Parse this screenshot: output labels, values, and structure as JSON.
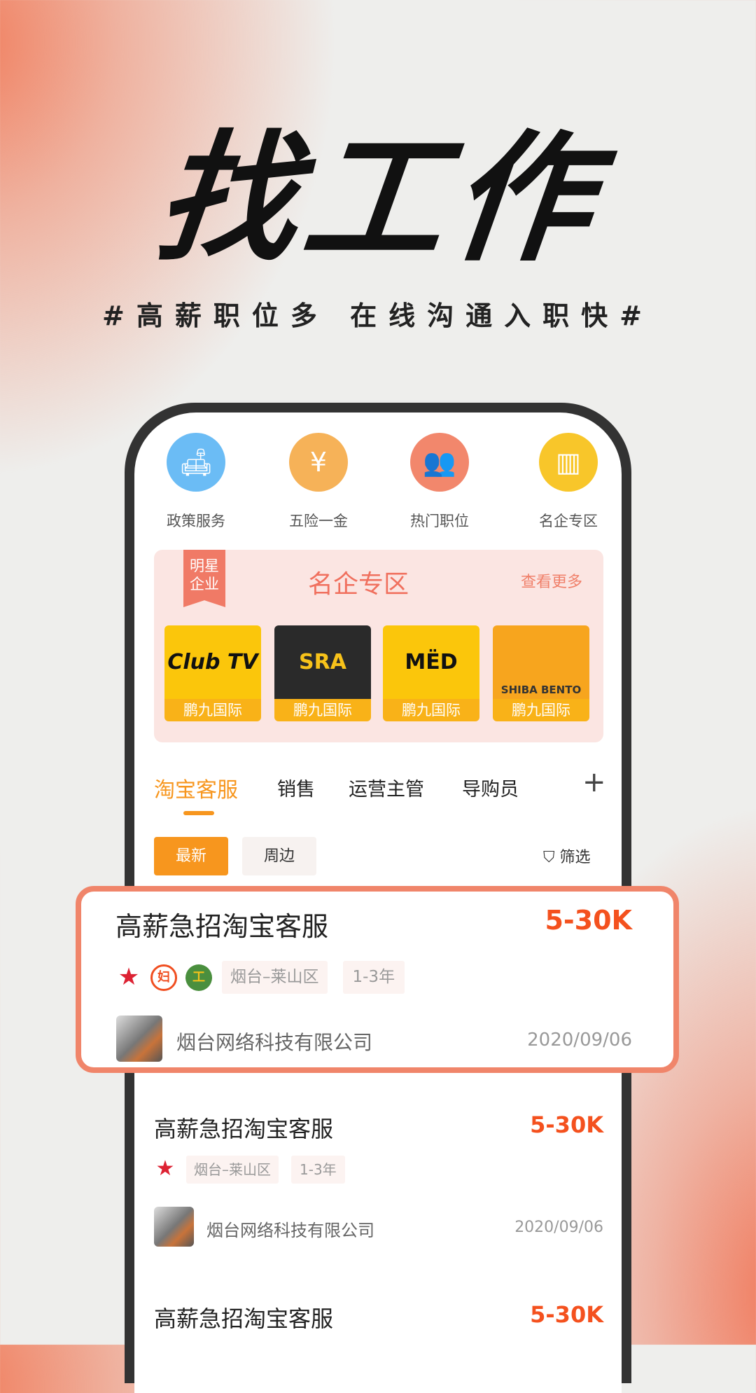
{
  "hero": {
    "title": "找工作",
    "subtitle": "#高薪职位多 在线沟通入职快#"
  },
  "quick": [
    {
      "label": "政策服务",
      "icon": "sofa-icon",
      "color": "#6bbcf5"
    },
    {
      "label": "五险一金",
      "icon": "yen-ticket-icon",
      "color": "#f6b258"
    },
    {
      "label": "热门职位",
      "icon": "people-icon",
      "color": "#f2876c"
    },
    {
      "label": "名企专区",
      "icon": "building-icon",
      "color": "#f8c62a"
    }
  ],
  "banner": {
    "ribbon": "明星企业",
    "title": "名企专区",
    "more": "查看更多",
    "logos": [
      {
        "brand": "Club TV",
        "name": "鹏九国际"
      },
      {
        "brand": "SRA",
        "name": "鹏九国际"
      },
      {
        "brand": "MËD",
        "name": "鹏九国际"
      },
      {
        "brand": "SHIBA BENTO",
        "name": "鹏九国际"
      }
    ]
  },
  "tabs": [
    "淘宝客服",
    "销售",
    "运营主管",
    "导购员"
  ],
  "filters": {
    "latest": "最新",
    "nearby": "周边",
    "filter": "筛选"
  },
  "jobs": [
    {
      "title": "高薪急招淘宝客服",
      "salary": "5-30K",
      "location": "烟台–莱山区",
      "experience": "1-3年",
      "company": "烟台网络科技有限公司",
      "date": "2020/09/06"
    },
    {
      "title": "高薪急招淘宝客服",
      "salary": "5-30K",
      "location": "烟台–莱山区",
      "experience": "1-3年",
      "company": "烟台网络科技有限公司",
      "date": "2020/09/06"
    },
    {
      "title": "高薪急招淘宝客服",
      "salary": "5-30K"
    }
  ],
  "colors": {
    "accent": "#f7961e",
    "salary": "#f4511e",
    "highlight": "#f0856a"
  }
}
